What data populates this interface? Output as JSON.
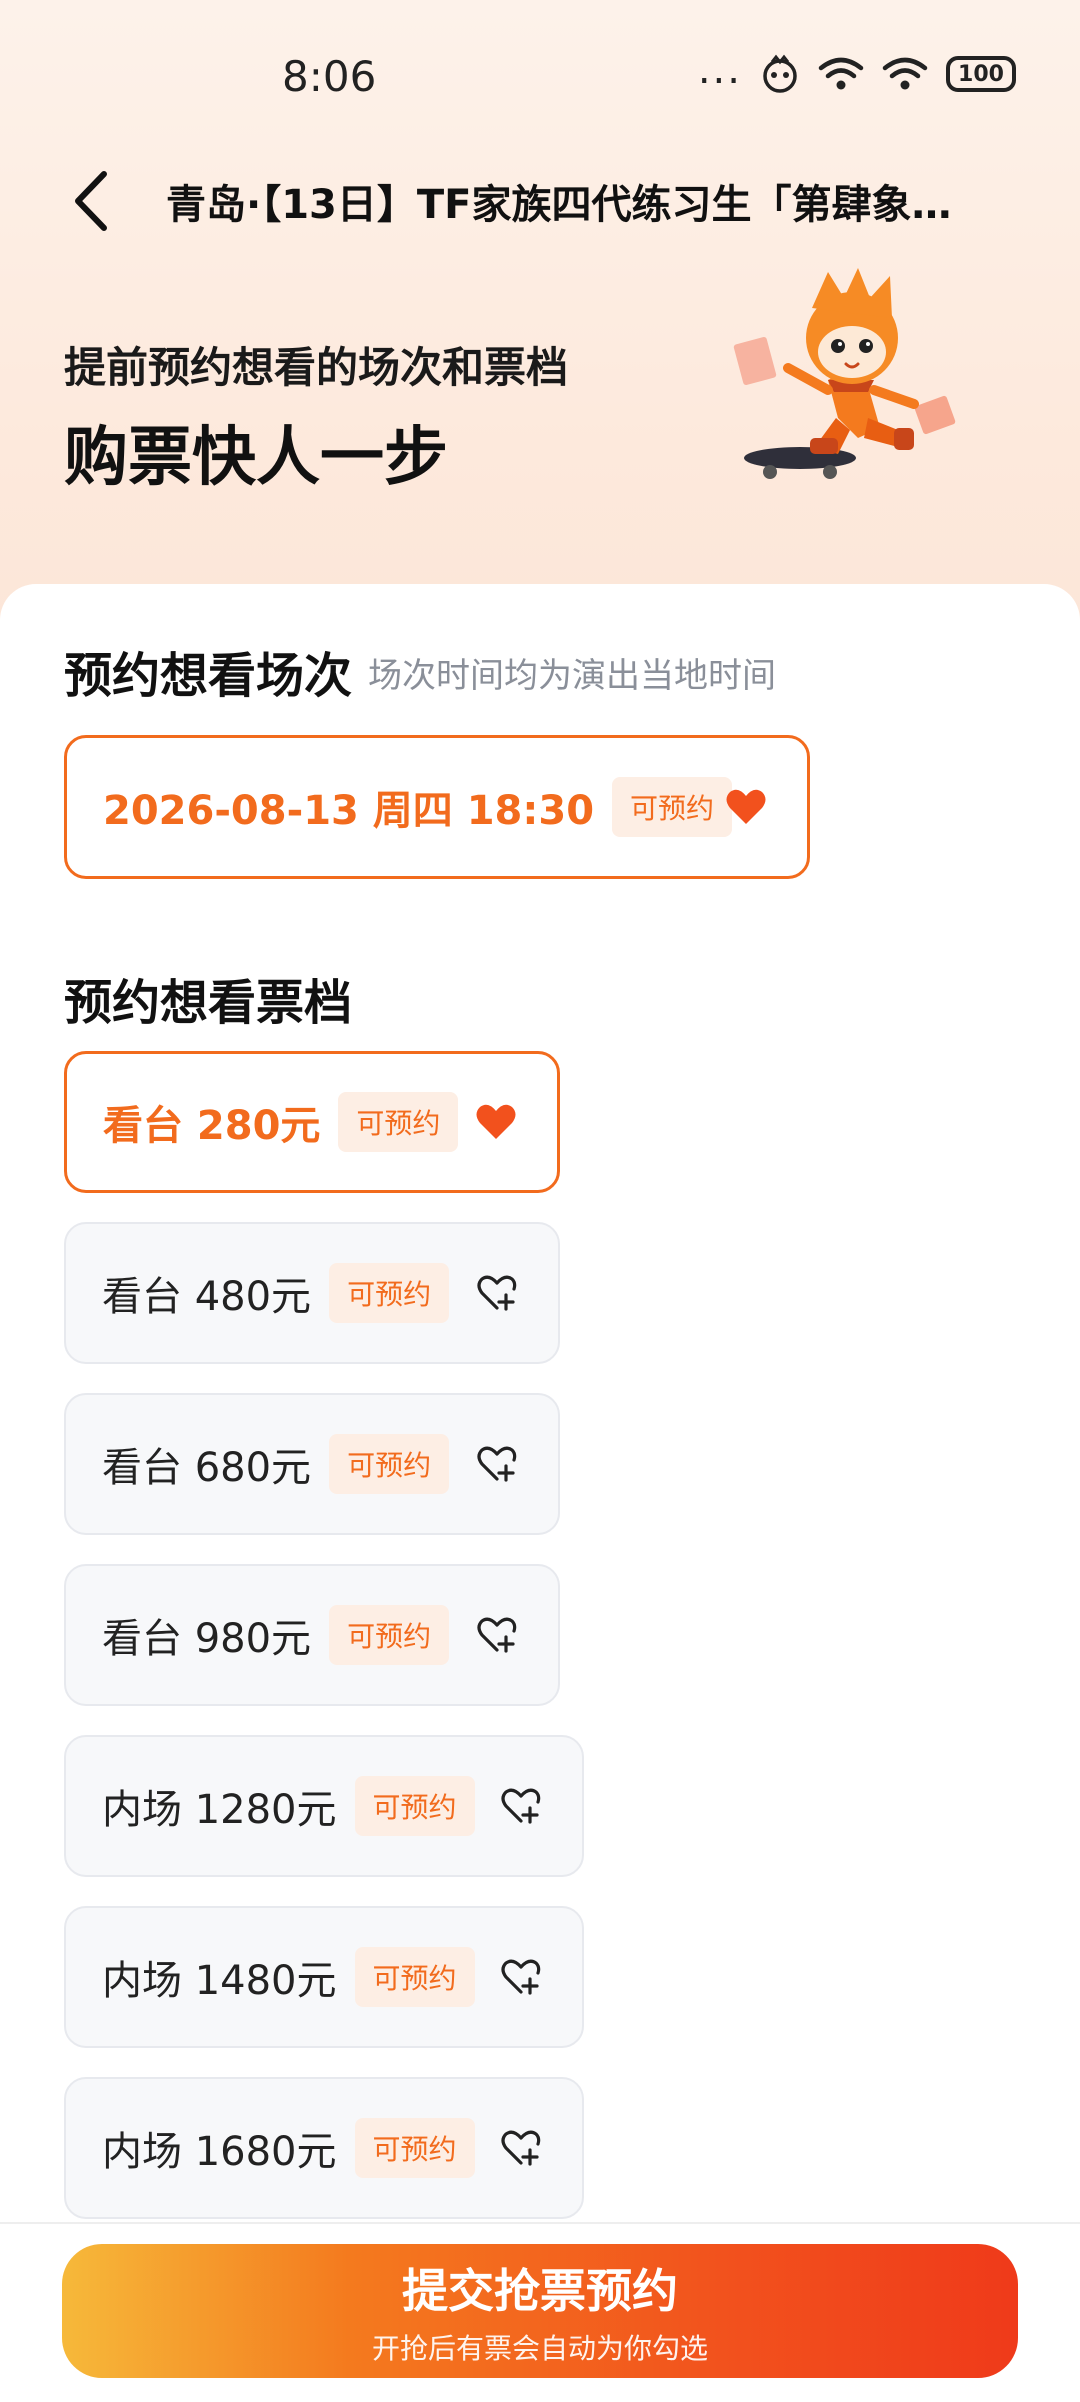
{
  "status": {
    "time": "8:06",
    "dots": "...",
    "battery": "100"
  },
  "header": {
    "title": "青岛·【13日】TF家族四代练习生「第肆象…"
  },
  "hero": {
    "subtitle": "提前预约想看的场次和票档",
    "headline": "购票快人一步"
  },
  "session_section": {
    "title": "预约想看场次",
    "note": "场次时间均为演出当地时间",
    "sessions": [
      {
        "label": "2026-08-13  周四 18:30",
        "badge": "可预约",
        "selected": true
      }
    ]
  },
  "ticket_section": {
    "title": "预约想看票档",
    "tiers": [
      {
        "label": "看台 280元",
        "badge": "可预约",
        "selected": true
      },
      {
        "label": "看台 480元",
        "badge": "可预约",
        "selected": false
      },
      {
        "label": "看台 680元",
        "badge": "可预约",
        "selected": false
      },
      {
        "label": "看台 980元",
        "badge": "可预约",
        "selected": false
      },
      {
        "label": "内场 1280元",
        "badge": "可预约",
        "selected": false
      },
      {
        "label": "内场 1480元",
        "badge": "可预约",
        "selected": false
      },
      {
        "label": "内场 1680元",
        "badge": "可预约",
        "selected": false
      }
    ]
  },
  "submit": {
    "label": "提交抢票预约",
    "sublabel": "开抢后有票会自动为你勾选"
  },
  "colors": {
    "accent": "#f26b1d",
    "badge_bg": "#fdeee4"
  }
}
